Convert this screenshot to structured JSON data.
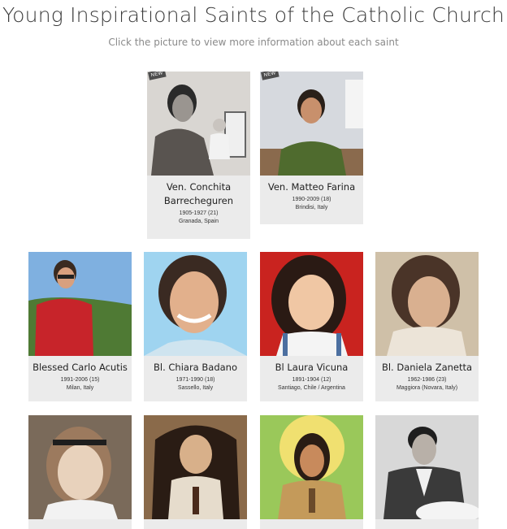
{
  "header": {
    "title": "Young Inspirational Saints of the Catholic Church",
    "subtitle": "Click the picture to view more information about each saint"
  },
  "badge_text": "NEW",
  "saints": [
    {
      "name": "Ven. Conchita Barrecheguren",
      "years": "1905-1927 (21)",
      "place": "Granada, Spain",
      "new": true
    },
    {
      "name": "Ven. Matteo Farina",
      "years": "1990-2009 (18)",
      "place": "Brindisi, Italy",
      "new": true
    },
    {
      "name": "Blessed Carlo Acutis",
      "years": "1991-2006 (15)",
      "place": "Milan, Italy"
    },
    {
      "name": "Bl. Chiara Badano",
      "years": "1971-1990 (18)",
      "place": "Sassello, Italy"
    },
    {
      "name": "Bl Laura Vicuna",
      "years": "1891-1904 (12)",
      "place": "Santiago, Chile / Argentina"
    },
    {
      "name": "Bl. Daniela Zanetta",
      "years": "1962-1986 (23)",
      "place": "Maggiora (Novara, Italy)"
    }
  ],
  "icons": [
    "portrait-photo-icon"
  ]
}
